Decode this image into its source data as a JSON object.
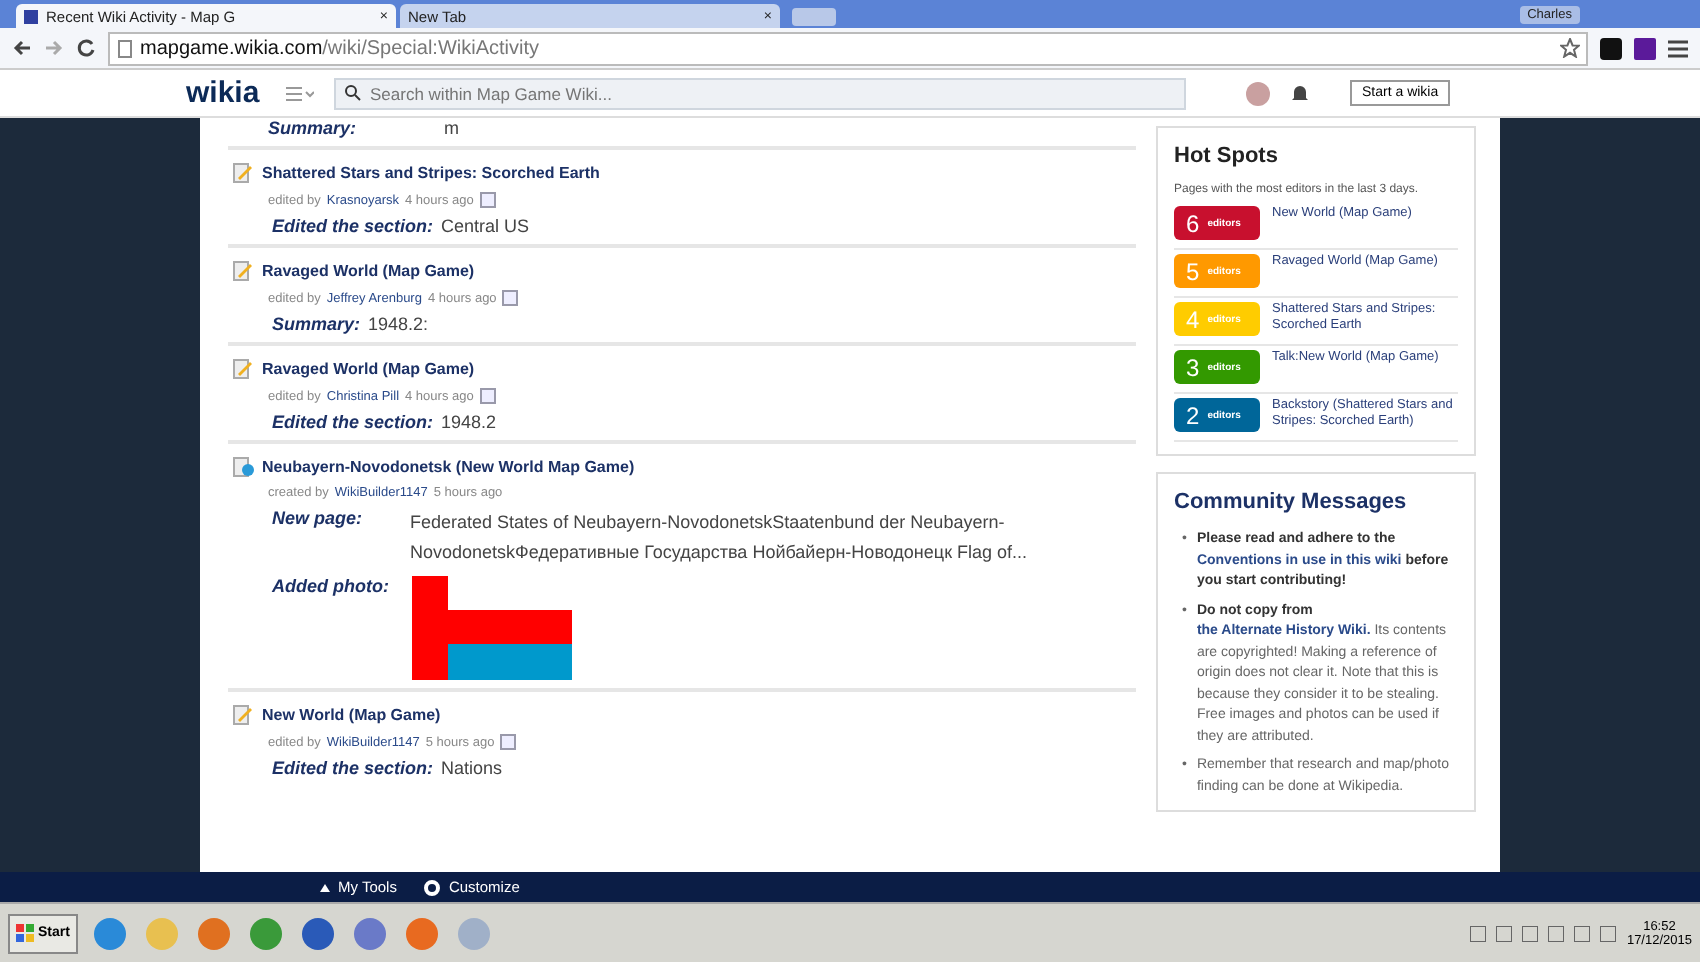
{
  "browser": {
    "tabs": [
      {
        "label": "Recent Wiki Activity - Map G",
        "selected": true,
        "close": "×"
      },
      {
        "label": "New Tab",
        "selected": false,
        "close": "×"
      }
    ],
    "user": "Charles",
    "address": {
      "host": "mapgame.wikia.com",
      "path": "/wiki/Special:WikiActivity"
    }
  },
  "wiki_header": {
    "logo": "wikia",
    "search": {
      "placeholder": "Search within Map Game Wiki..."
    },
    "start_button": "Start a wikia"
  },
  "activity": {
    "top_summary": {
      "label": "Summary:",
      "value": "m"
    },
    "entries": [
      {
        "kind": "edit",
        "title": "Shattered Stars and Stripes: Scorched Earth",
        "action": "edited by",
        "user": "Krasnoyarsk",
        "time": "4 hours ago",
        "detail_label": "Edited the section:",
        "detail": "Central US"
      },
      {
        "kind": "edit",
        "title": "Ravaged World (Map Game)",
        "action": "edited by",
        "user": "Jeffrey Arenburg",
        "time": "4 hours ago",
        "detail_label": "Summary:",
        "detail": "1948.2:"
      },
      {
        "kind": "edit",
        "title": "Ravaged World (Map Game)",
        "action": "edited by",
        "user": "Christina Pill",
        "time": "4 hours ago",
        "detail_label": "Edited the section:",
        "detail": "1948.2"
      },
      {
        "kind": "new",
        "title": "Neubayern-Novodonetsk (New World Map Game)",
        "action": "created by",
        "user": "WikiBuilder1147",
        "time": "5 hours ago",
        "detail_label": "New page:",
        "detail": "Federated States of Neubayern-NovodonetskStaatenbund der Neubayern-NovodonetskФедеративные Государства Нойбайерн-Новодонецк Flag of...",
        "photo_label": "Added photo:"
      },
      {
        "kind": "edit",
        "title": "New World (Map Game)",
        "action": "edited by",
        "user": "WikiBuilder1147",
        "time": "5 hours ago",
        "detail_label": "Edited the section:",
        "detail": "Nations"
      }
    ]
  },
  "hot_spots": {
    "title": "Hot Spots",
    "subtitle": "Pages with the most editors in the last 3 days.",
    "items": [
      {
        "count": "6",
        "unit": "editors",
        "color": "#c8102e",
        "page": "New World (Map Game)"
      },
      {
        "count": "5",
        "unit": "editors",
        "color": "#ff9900",
        "page": "Ravaged World (Map Game)"
      },
      {
        "count": "4",
        "unit": "editors",
        "color": "#ffcc00",
        "page": "Shattered Stars and Stripes: Scorched Earth"
      },
      {
        "count": "3",
        "unit": "editors",
        "color": "#339900",
        "page": "Talk:New World (Map Game)"
      },
      {
        "count": "2",
        "unit": "editors",
        "color": "#006699",
        "page": "Backstory (Shattered Stars and Stripes: Scorched Earth)"
      }
    ]
  },
  "community": {
    "title": "Community Messages",
    "messages": [
      {
        "bullet": "•",
        "parts": [
          {
            "kind": "bold",
            "text": "Please read and adhere to the"
          },
          {
            "kind": "link",
            "text": "Conventions in use in this wiki"
          },
          {
            "kind": "bold",
            "text": "before you start contributing!"
          }
        ]
      },
      {
        "bullet": "•",
        "parts": [
          {
            "kind": "bold",
            "text": "Do not copy from"
          },
          {
            "kind": "link",
            "text": "the Alternate History Wiki."
          },
          {
            "kind": "plain",
            "text": "Its contents are copyrighted! Making a reference of origin does not clear it. Note that this is because they consider it to be stealing. Free images and photos can be used if they are attributed."
          }
        ]
      },
      {
        "bullet": "•",
        "parts": [
          {
            "kind": "plain",
            "text": "Remember that research and map/photo finding can be done at Wikipedia."
          }
        ]
      }
    ]
  },
  "toolbar": {
    "items": [
      "My Tools",
      "Customize"
    ]
  },
  "taskbar": {
    "start": "Start",
    "time": "16:52",
    "date": "17/12/2015"
  }
}
